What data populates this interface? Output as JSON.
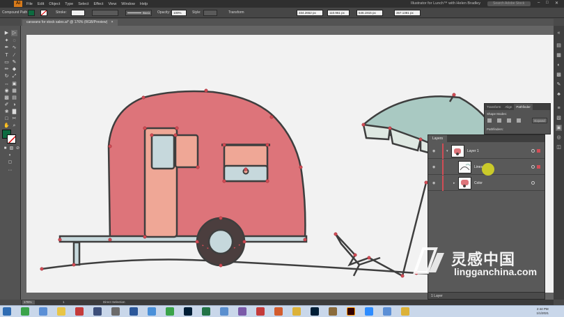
{
  "app": {
    "logo_text": "Ai",
    "menu": [
      "File",
      "Edit",
      "Object",
      "Type",
      "Select",
      "Effect",
      "View",
      "Window",
      "Help"
    ],
    "window_title": "Illustrator for Lunch™ with Helen Bradley",
    "search_placeholder": "Search Adobe Stock",
    "window_controls": [
      "–",
      "□",
      "✕"
    ]
  },
  "control_bar": {
    "selection_label": "Compound Path",
    "stroke_label": "Stroke:",
    "brush_label": "Basic",
    "opacity_label": "Opacity:",
    "opacity_value": "100%",
    "style_label": "Style:",
    "transform_label": "Transform",
    "x_value": "334.2652 px",
    "y_value": "110.961 px",
    "w_value": "546.1915 px",
    "h_value": "357.1381 px"
  },
  "document": {
    "tab_label": "caravans for stock sales.ai* @ 176% (RGB/Preview)",
    "tab_close": "×"
  },
  "pathfinder": {
    "tabs": [
      "Transform",
      "Align",
      "Pathfinder"
    ],
    "shape_modes_label": "Shape Modes:",
    "expand_label": "Expand",
    "pathfinders_label": "Pathfinders:"
  },
  "layers": {
    "tab_label": "Layers",
    "rows": [
      {
        "name": "Layer 1",
        "level": 0
      },
      {
        "name": "Lines",
        "level": 1
      },
      {
        "name": "Color",
        "level": 1
      }
    ],
    "footer": "1 Layer"
  },
  "status": {
    "zoom": "176%",
    "page": "1",
    "selection_tool": "Direct Selection"
  },
  "taskbar": {
    "time": "2:44 PM",
    "date": "1/1/2021"
  },
  "watermark": {
    "chinese": "灵感中国",
    "url": "lingganchina.com"
  },
  "colors": {
    "caravan_body": "#dd747a",
    "door": "#efa796",
    "window_blue": "#c6d8dc",
    "outline": "#3e3e3e",
    "selection_point": "#d24d56",
    "wheel": "#4b3e3e",
    "umbrella": "#a9c9c2",
    "fill_swatch": "#0d6b40"
  },
  "icons": [
    "selection-icon",
    "direct-selection-icon",
    "pen-icon",
    "type-icon",
    "eye-icon",
    "trash-icon",
    "zoom-icon",
    "hand-icon"
  ]
}
